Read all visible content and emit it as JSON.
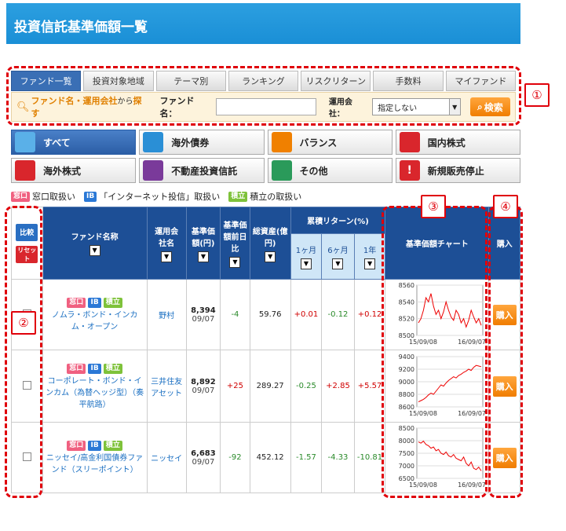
{
  "header": {
    "title": "投資信託基準価額一覧"
  },
  "tabs": [
    "ファンド一覧",
    "投資対象地域",
    "テーマ別",
    "ランキング",
    "リスクリターン",
    "手数料",
    "マイファンド"
  ],
  "search": {
    "title_prefix": "ファンド名・運用会社",
    "title_mid": "から",
    "title_suffix": "探す",
    "fund_label": "ファンド名：",
    "company_label": "運用会社：",
    "company_value": "指定しない",
    "button": "検索"
  },
  "categories": [
    {
      "label": "すべて",
      "color": "#2a8fd6"
    },
    {
      "label": "海外債券",
      "color": "#2a8fd6"
    },
    {
      "label": "バランス",
      "color": "#f08000"
    },
    {
      "label": "国内株式",
      "color": "#d9262c"
    },
    {
      "label": "海外株式",
      "color": "#d9262c"
    },
    {
      "label": "不動産投資信託",
      "color": "#7a3a9a"
    },
    {
      "label": "その他",
      "color": "#2a9a5a"
    },
    {
      "label": "新規販売停止",
      "color": "#d9262c"
    }
  ],
  "legend": {
    "tag1": "窓口",
    "text1": "窓口取扱い",
    "tag2": "IB",
    "text2": "「インターネット投信」取扱い",
    "tag3": "積立",
    "text3": "積立の取扱い"
  },
  "table": {
    "headers": {
      "compare": "比較",
      "reset": "リセット",
      "fund_name": "ファンド名称",
      "company": "運用会社名",
      "nav": "基準価額(円)",
      "change": "基準価額前日比",
      "assets": "総資産(億円)",
      "returns": "累積リターン(%)",
      "r1m": "1ヶ月",
      "r6m": "6ヶ月",
      "r1y": "1年",
      "chart": "基準価額チャート",
      "buy": "購入"
    },
    "filter_symbol": "▼",
    "tags": [
      "窓口",
      "IB",
      "積立"
    ],
    "buy_label": "購入",
    "rows": [
      {
        "name": "ノムラ・ボンド・インカム・オープン",
        "company": "野村",
        "nav": "8,394",
        "date": "09/07",
        "change": "-4",
        "assets": "59.76",
        "r1m": "+0.01",
        "r6m": "-0.12",
        "r1y": "+0.12"
      },
      {
        "name": "コーポレート・ボンド・インカム（為替ヘッジ型）（奏平航路）",
        "company": "三井住友アセット",
        "nav": "8,892",
        "date": "09/07",
        "change": "+25",
        "assets": "289.27",
        "r1m": "-0.25",
        "r6m": "+2.85",
        "r1y": "+5.57"
      },
      {
        "name": "ニッセイ/高金利国債券ファンド（スリーポイント）",
        "company": "ニッセイ",
        "nav": "6,683",
        "date": "09/07",
        "change": "-92",
        "assets": "452.12",
        "r1m": "-1.57",
        "r6m": "-4.33",
        "r1y": "-10.81"
      }
    ]
  },
  "charts": [
    {
      "y_ticks": [
        "8560",
        "8540",
        "8520",
        "8500"
      ],
      "x_start": "15/09/08",
      "x_end": "16/09/07",
      "ylim": [
        8500,
        8560
      ],
      "values": [
        8515,
        8520,
        8530,
        8545,
        8540,
        8550,
        8535,
        8525,
        8530,
        8520,
        8528,
        8540,
        8530,
        8522,
        8518,
        8530,
        8525,
        8515,
        8520,
        8510,
        8518,
        8530,
        8522,
        8515,
        8520,
        8512
      ]
    },
    {
      "y_ticks": [
        "9400",
        "9200",
        "9000",
        "8800",
        "8600"
      ],
      "x_start": "15/09/08",
      "x_end": "16/09/07",
      "ylim": [
        8600,
        9400
      ],
      "values": [
        8680,
        8700,
        8720,
        8750,
        8790,
        8820,
        8800,
        8850,
        8900,
        8950,
        8930,
        8980,
        9020,
        9050,
        9080,
        9060,
        9100,
        9120,
        9150,
        9170,
        9200,
        9180,
        9230,
        9260,
        9250,
        9240
      ]
    },
    {
      "y_ticks": [
        "8500",
        "8000",
        "7500",
        "7000",
        "6500"
      ],
      "x_start": "15/09/08",
      "x_end": "16/09/07",
      "ylim": [
        6500,
        8500
      ],
      "values": [
        7950,
        7900,
        7980,
        7850,
        7800,
        7700,
        7750,
        7600,
        7650,
        7500,
        7450,
        7550,
        7400,
        7350,
        7450,
        7300,
        7250,
        7200,
        7350,
        7100,
        7000,
        7150,
        6900,
        6850,
        6950,
        6800
      ]
    }
  ],
  "annotations": [
    "①",
    "②",
    "③",
    "④"
  ]
}
